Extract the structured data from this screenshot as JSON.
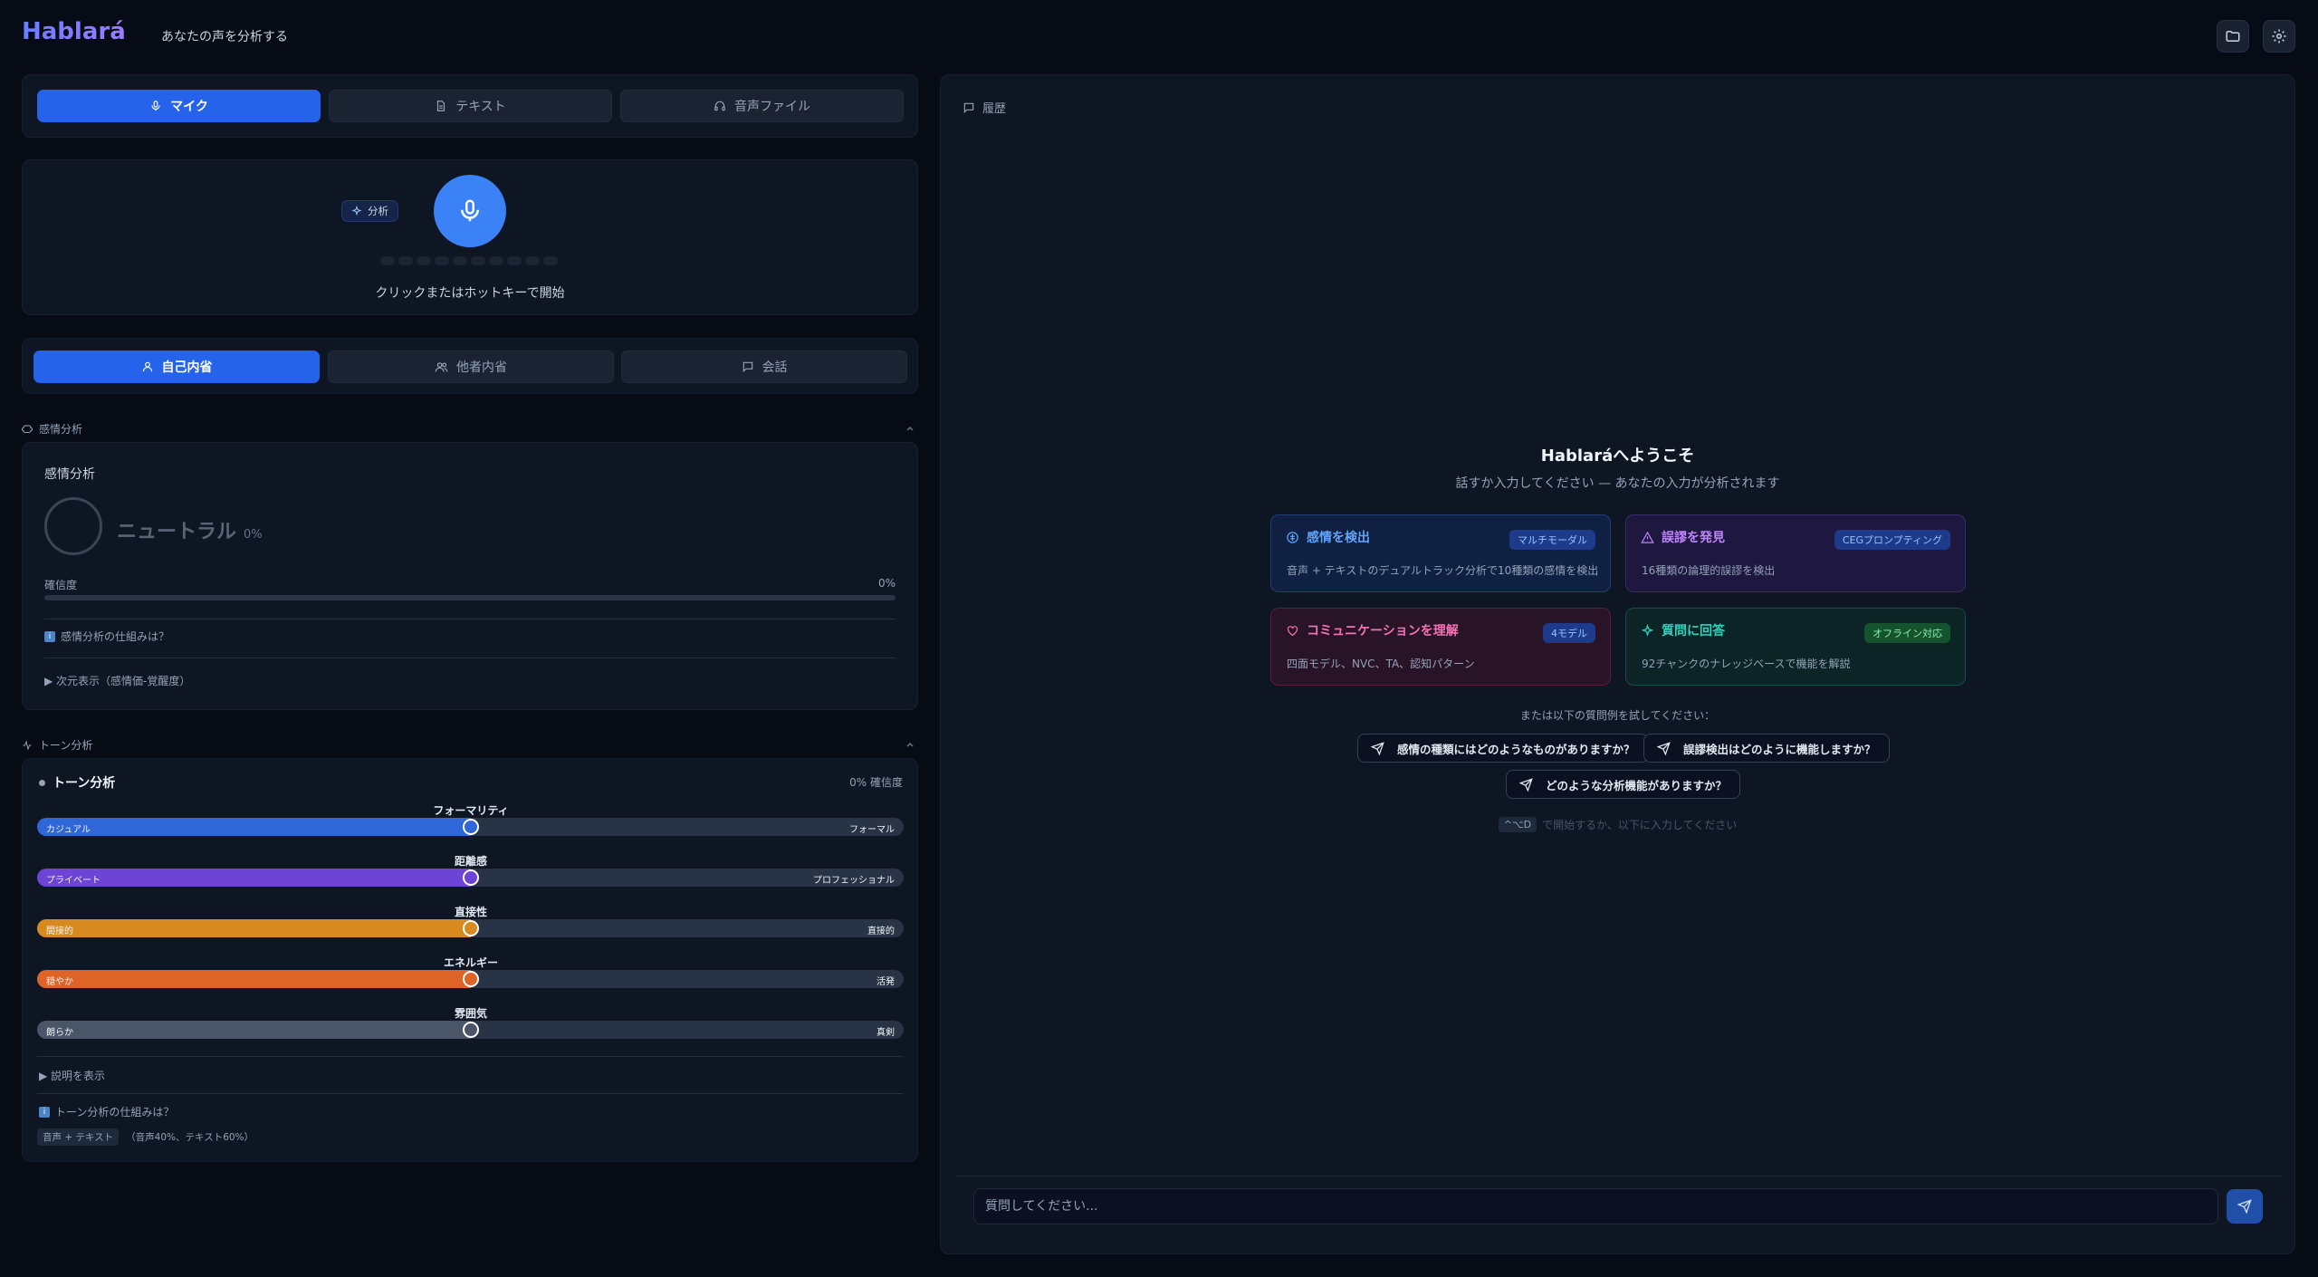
{
  "header": {
    "logo": "Hablará",
    "tagline": "あなたの声を分析する",
    "folder_icon": "folder-icon",
    "settings_icon": "gear-icon"
  },
  "input_tabs": [
    {
      "label": "マイク",
      "icon": "mic-icon",
      "active": true
    },
    {
      "label": "テキスト",
      "icon": "document-icon",
      "active": false
    },
    {
      "label": "音声ファイル",
      "icon": "headphones-icon",
      "active": false
    }
  ],
  "recorder": {
    "analyze_badge": "分析",
    "hint": "クリックまたはホットキーで開始"
  },
  "mode_tabs": [
    {
      "label": "自己内省",
      "icon": "user-icon",
      "active": true
    },
    {
      "label": "他者内省",
      "icon": "users-icon",
      "active": false
    },
    {
      "label": "会話",
      "icon": "chat-icon",
      "active": false
    }
  ],
  "emotion": {
    "section_label": "感情分析",
    "card_title": "感情分析",
    "emotion_name": "ニュートラル",
    "emotion_pct": "0%",
    "confidence_label": "確信度",
    "confidence_value": "0%",
    "confidence_fraction": 0,
    "how_it_works": "感情分析の仕組みは？",
    "dimension_toggle": "▶ 次元表示（感情価-覚醒度）"
  },
  "tone": {
    "section_label": "トーン分析",
    "card_title": "トーン分析",
    "confidence": "0% 確信度",
    "dimensions": [
      {
        "title": "フォーマリティ",
        "left": "カジュアル",
        "right": "フォーマル",
        "color": "#2f67d8",
        "value": 0.5
      },
      {
        "title": "距離感",
        "left": "プライベート",
        "right": "プロフェッショナル",
        "color": "#6d44d6",
        "value": 0.5
      },
      {
        "title": "直接性",
        "left": "間接的",
        "right": "直接的",
        "color": "#d98a1f",
        "value": 0.5
      },
      {
        "title": "エネルギー",
        "left": "穏やか",
        "right": "活発",
        "color": "#dd6426",
        "value": 0.5
      },
      {
        "title": "雰囲気",
        "left": "朗らか",
        "right": "真剣",
        "color": "#4b5568",
        "value": 0.5
      }
    ],
    "explain_toggle": "▶ 説明を表示",
    "how_it_works": "トーン分析の仕組みは？",
    "source_chip": "音声 + テキスト",
    "source_weights": "（音声40%、テキスト60%）"
  },
  "chat": {
    "history_label": "履歴",
    "welcome_title": "Hablaráへようこそ",
    "welcome_sub": "話すか入力してください — あなたの入力が分析されます",
    "cards": [
      {
        "title": "感情を検出",
        "badge": "マルチモーダル",
        "desc": "音声 + テキストのデュアルトラック分析で10種類の感情を検出",
        "icon": "brain-icon",
        "color": "#60a5fa"
      },
      {
        "title": "誤謬を発見",
        "badge": "CEGプロンプティング",
        "desc": "16種類の論理的誤謬を検出",
        "icon": "warning-icon",
        "color": "#c084fc"
      },
      {
        "title": "コミュニケーションを理解",
        "badge": "4モデル",
        "desc": "四面モデル、NVC、TA、認知パターン",
        "icon": "heart-icon",
        "color": "#f472b6"
      },
      {
        "title": "質問に回答",
        "badge": "オフライン対応",
        "desc": "92チャンクのナレッジベースで機能を解説",
        "icon": "sparkle-icon",
        "color": "#2dd4bf"
      }
    ],
    "try_label": "または以下の質問例を試してください：",
    "suggestions": [
      "感情の種類にはどのようなものがありますか？",
      "誤謬検出はどのように機能しますか？",
      "どのような分析機能がありますか？"
    ],
    "shortcut_key": "^⌥D",
    "shortcut_text": "で開始するか、以下に入力してください",
    "input_placeholder": "質問してください..."
  }
}
